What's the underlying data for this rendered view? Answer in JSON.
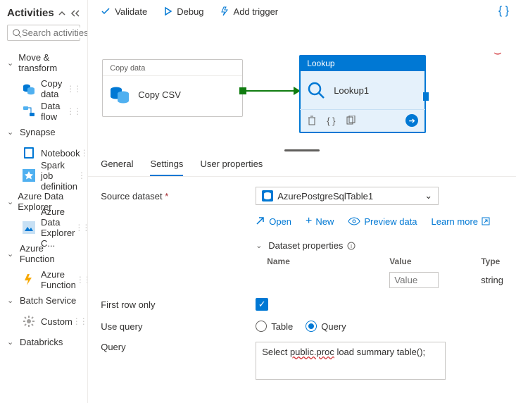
{
  "sidebar": {
    "title": "Activities",
    "search_placeholder": "Search activities",
    "groups": [
      {
        "label": "Move & transform",
        "items": [
          {
            "label": "Copy data",
            "icon": "copy-data"
          },
          {
            "label": "Data flow",
            "icon": "data-flow"
          }
        ]
      },
      {
        "label": "Synapse",
        "items": [
          {
            "label": "Notebook",
            "icon": "notebook"
          },
          {
            "label": "Spark job definition",
            "icon": "spark"
          }
        ]
      },
      {
        "label": "Azure Data Explorer",
        "items": [
          {
            "label": "Azure Data Explorer C...",
            "icon": "adx"
          }
        ]
      },
      {
        "label": "Azure Function",
        "items": [
          {
            "label": "Azure Function",
            "icon": "function"
          }
        ]
      },
      {
        "label": "Batch Service",
        "items": [
          {
            "label": "Custom",
            "icon": "gear"
          }
        ]
      },
      {
        "label": "Databricks",
        "items": []
      }
    ]
  },
  "toolbar": {
    "validate": "Validate",
    "debug": "Debug",
    "add_trigger": "Add trigger"
  },
  "canvas": {
    "copy_node": {
      "heading": "Copy data",
      "title": "Copy CSV"
    },
    "lookup_node": {
      "heading": "Lookup",
      "title": "Lookup1"
    }
  },
  "tabs": {
    "general": "General",
    "settings": "Settings",
    "user_props": "User properties"
  },
  "settings": {
    "source_dataset_label": "Source dataset",
    "source_dataset_value": "AzurePostgreSqlTable1",
    "open": "Open",
    "new": "New",
    "preview": "Preview data",
    "learn_more": "Learn more",
    "dataset_props_label": "Dataset properties",
    "dp_cols": {
      "name": "Name",
      "value": "Value",
      "type": "Type"
    },
    "dp_row": {
      "name": "",
      "value_placeholder": "Value",
      "type": "string"
    },
    "first_row_label": "First row only",
    "first_row_checked": true,
    "use_query_label": "Use query",
    "radios": {
      "table": "Table",
      "query": "Query",
      "selected": "query"
    },
    "query_label": "Query",
    "query_value_pre": "Select ",
    "query_value_err": "public.proc",
    "query_value_post": " load summary table();"
  }
}
